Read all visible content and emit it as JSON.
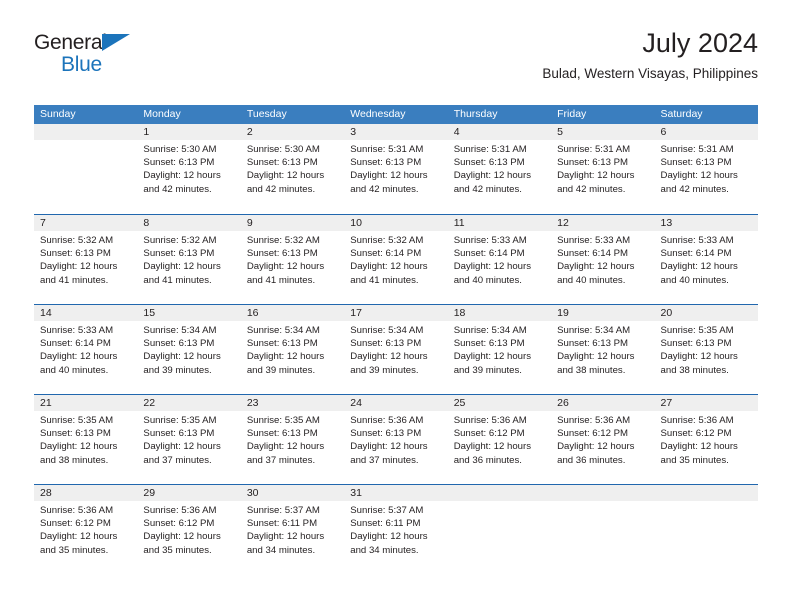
{
  "brand": {
    "word_top": "General",
    "word_bottom": "Blue",
    "triangle_icon": "triangle-icon",
    "accent_color": "#1c74bb"
  },
  "header": {
    "title": "July 2024",
    "subtitle": "Bulad, Western Visayas, Philippines"
  },
  "calendar": {
    "header_bg": "#3a7ebf",
    "row_border_color": "#2167ae",
    "daynum_bg": "#efefef",
    "weekdays": [
      "Sunday",
      "Monday",
      "Tuesday",
      "Wednesday",
      "Thursday",
      "Friday",
      "Saturday"
    ],
    "weeks": [
      [
        {
          "day": "",
          "lines": []
        },
        {
          "day": "1",
          "lines": [
            "Sunrise: 5:30 AM",
            "Sunset: 6:13 PM",
            "Daylight: 12 hours",
            "and 42 minutes."
          ]
        },
        {
          "day": "2",
          "lines": [
            "Sunrise: 5:30 AM",
            "Sunset: 6:13 PM",
            "Daylight: 12 hours",
            "and 42 minutes."
          ]
        },
        {
          "day": "3",
          "lines": [
            "Sunrise: 5:31 AM",
            "Sunset: 6:13 PM",
            "Daylight: 12 hours",
            "and 42 minutes."
          ]
        },
        {
          "day": "4",
          "lines": [
            "Sunrise: 5:31 AM",
            "Sunset: 6:13 PM",
            "Daylight: 12 hours",
            "and 42 minutes."
          ]
        },
        {
          "day": "5",
          "lines": [
            "Sunrise: 5:31 AM",
            "Sunset: 6:13 PM",
            "Daylight: 12 hours",
            "and 42 minutes."
          ]
        },
        {
          "day": "6",
          "lines": [
            "Sunrise: 5:31 AM",
            "Sunset: 6:13 PM",
            "Daylight: 12 hours",
            "and 42 minutes."
          ]
        }
      ],
      [
        {
          "day": "7",
          "lines": [
            "Sunrise: 5:32 AM",
            "Sunset: 6:13 PM",
            "Daylight: 12 hours",
            "and 41 minutes."
          ]
        },
        {
          "day": "8",
          "lines": [
            "Sunrise: 5:32 AM",
            "Sunset: 6:13 PM",
            "Daylight: 12 hours",
            "and 41 minutes."
          ]
        },
        {
          "day": "9",
          "lines": [
            "Sunrise: 5:32 AM",
            "Sunset: 6:13 PM",
            "Daylight: 12 hours",
            "and 41 minutes."
          ]
        },
        {
          "day": "10",
          "lines": [
            "Sunrise: 5:32 AM",
            "Sunset: 6:14 PM",
            "Daylight: 12 hours",
            "and 41 minutes."
          ]
        },
        {
          "day": "11",
          "lines": [
            "Sunrise: 5:33 AM",
            "Sunset: 6:14 PM",
            "Daylight: 12 hours",
            "and 40 minutes."
          ]
        },
        {
          "day": "12",
          "lines": [
            "Sunrise: 5:33 AM",
            "Sunset: 6:14 PM",
            "Daylight: 12 hours",
            "and 40 minutes."
          ]
        },
        {
          "day": "13",
          "lines": [
            "Sunrise: 5:33 AM",
            "Sunset: 6:14 PM",
            "Daylight: 12 hours",
            "and 40 minutes."
          ]
        }
      ],
      [
        {
          "day": "14",
          "lines": [
            "Sunrise: 5:33 AM",
            "Sunset: 6:14 PM",
            "Daylight: 12 hours",
            "and 40 minutes."
          ]
        },
        {
          "day": "15",
          "lines": [
            "Sunrise: 5:34 AM",
            "Sunset: 6:13 PM",
            "Daylight: 12 hours",
            "and 39 minutes."
          ]
        },
        {
          "day": "16",
          "lines": [
            "Sunrise: 5:34 AM",
            "Sunset: 6:13 PM",
            "Daylight: 12 hours",
            "and 39 minutes."
          ]
        },
        {
          "day": "17",
          "lines": [
            "Sunrise: 5:34 AM",
            "Sunset: 6:13 PM",
            "Daylight: 12 hours",
            "and 39 minutes."
          ]
        },
        {
          "day": "18",
          "lines": [
            "Sunrise: 5:34 AM",
            "Sunset: 6:13 PM",
            "Daylight: 12 hours",
            "and 39 minutes."
          ]
        },
        {
          "day": "19",
          "lines": [
            "Sunrise: 5:34 AM",
            "Sunset: 6:13 PM",
            "Daylight: 12 hours",
            "and 38 minutes."
          ]
        },
        {
          "day": "20",
          "lines": [
            "Sunrise: 5:35 AM",
            "Sunset: 6:13 PM",
            "Daylight: 12 hours",
            "and 38 minutes."
          ]
        }
      ],
      [
        {
          "day": "21",
          "lines": [
            "Sunrise: 5:35 AM",
            "Sunset: 6:13 PM",
            "Daylight: 12 hours",
            "and 38 minutes."
          ]
        },
        {
          "day": "22",
          "lines": [
            "Sunrise: 5:35 AM",
            "Sunset: 6:13 PM",
            "Daylight: 12 hours",
            "and 37 minutes."
          ]
        },
        {
          "day": "23",
          "lines": [
            "Sunrise: 5:35 AM",
            "Sunset: 6:13 PM",
            "Daylight: 12 hours",
            "and 37 minutes."
          ]
        },
        {
          "day": "24",
          "lines": [
            "Sunrise: 5:36 AM",
            "Sunset: 6:13 PM",
            "Daylight: 12 hours",
            "and 37 minutes."
          ]
        },
        {
          "day": "25",
          "lines": [
            "Sunrise: 5:36 AM",
            "Sunset: 6:12 PM",
            "Daylight: 12 hours",
            "and 36 minutes."
          ]
        },
        {
          "day": "26",
          "lines": [
            "Sunrise: 5:36 AM",
            "Sunset: 6:12 PM",
            "Daylight: 12 hours",
            "and 36 minutes."
          ]
        },
        {
          "day": "27",
          "lines": [
            "Sunrise: 5:36 AM",
            "Sunset: 6:12 PM",
            "Daylight: 12 hours",
            "and 35 minutes."
          ]
        }
      ],
      [
        {
          "day": "28",
          "lines": [
            "Sunrise: 5:36 AM",
            "Sunset: 6:12 PM",
            "Daylight: 12 hours",
            "and 35 minutes."
          ]
        },
        {
          "day": "29",
          "lines": [
            "Sunrise: 5:36 AM",
            "Sunset: 6:12 PM",
            "Daylight: 12 hours",
            "and 35 minutes."
          ]
        },
        {
          "day": "30",
          "lines": [
            "Sunrise: 5:37 AM",
            "Sunset: 6:11 PM",
            "Daylight: 12 hours",
            "and 34 minutes."
          ]
        },
        {
          "day": "31",
          "lines": [
            "Sunrise: 5:37 AM",
            "Sunset: 6:11 PM",
            "Daylight: 12 hours",
            "and 34 minutes."
          ]
        },
        {
          "day": "",
          "lines": []
        },
        {
          "day": "",
          "lines": []
        },
        {
          "day": "",
          "lines": []
        }
      ]
    ]
  }
}
